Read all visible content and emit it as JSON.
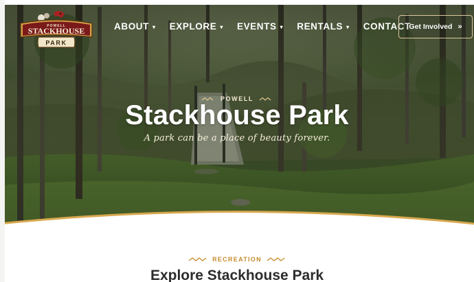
{
  "site": {
    "logo": {
      "small": "POWELL",
      "main": "STACKHOUSE",
      "sub": "PARK"
    }
  },
  "nav": {
    "items": [
      {
        "label": "ABOUT"
      },
      {
        "label": "EXPLORE"
      },
      {
        "label": "EVENTS"
      },
      {
        "label": "RENTALS"
      }
    ],
    "contact": "CONTACT",
    "cta": "Get Involved"
  },
  "hero": {
    "eyebrow": "POWELL",
    "title": "Stackhouse Park",
    "tagline": "A park can be a place of beauty forever."
  },
  "section": {
    "eyebrow": "RECREATION",
    "title": "Explore Stackhouse Park"
  },
  "colors": {
    "accent": "#d4a24a",
    "eyebrow": "#c58a2a",
    "logo_red": "#8b1e1e",
    "logo_gold": "#d8a24a"
  }
}
